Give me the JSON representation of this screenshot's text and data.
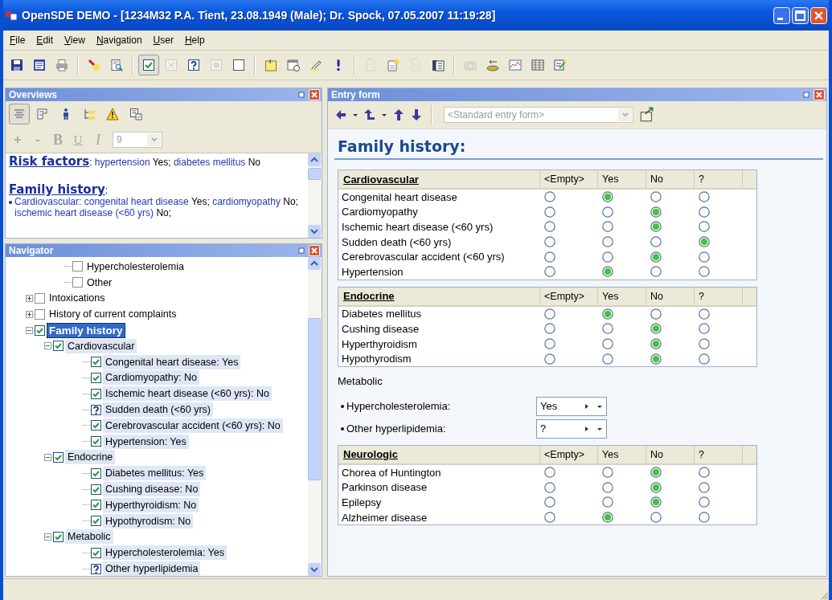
{
  "window": {
    "title": "OpenSDE DEMO - [1234M32 P.A. Tient, 23.08.1949 (Male); Dr. Spock, 07.05.2007 11:19:28]"
  },
  "menu": [
    "File",
    "Edit",
    "View",
    "Navigation",
    "User",
    "Help"
  ],
  "toolbar": [
    [
      {
        "pressed": false,
        "disabled": false
      },
      {
        "pressed": false,
        "disabled": false
      },
      {
        "pressed": false,
        "disabled": false
      }
    ],
    [
      {
        "pressed": false,
        "disabled": false
      },
      {
        "pressed": false,
        "disabled": false
      }
    ],
    [
      {
        "pressed": true,
        "disabled": false
      },
      {
        "pressed": false,
        "disabled": true
      },
      {
        "pressed": false,
        "disabled": false
      },
      {
        "pressed": false,
        "disabled": true
      },
      {
        "pressed": false,
        "disabled": false
      }
    ],
    [
      {
        "pressed": false,
        "disabled": false
      },
      {
        "pressed": false,
        "disabled": false
      },
      {
        "pressed": false,
        "disabled": false
      },
      {
        "pressed": false,
        "disabled": false
      }
    ],
    [
      {
        "pressed": false,
        "disabled": true
      },
      {
        "pressed": false,
        "disabled": false
      },
      {
        "pressed": false,
        "disabled": true
      },
      {
        "pressed": false,
        "disabled": false
      }
    ],
    [
      {
        "pressed": false,
        "disabled": true
      },
      {
        "pressed": false,
        "disabled": false
      },
      {
        "pressed": false,
        "disabled": false
      },
      {
        "pressed": false,
        "disabled": false
      },
      {
        "pressed": false,
        "disabled": false
      }
    ]
  ],
  "overviews": {
    "title": "Overviews",
    "tools": [
      {
        "pressed": true
      },
      {
        "pressed": false
      },
      {
        "pressed": false
      },
      {
        "pressed": false
      },
      {
        "pressed": false
      },
      {
        "pressed": false
      }
    ],
    "format_tools": [
      {
        "kind": "add",
        "label": "+",
        "disabled": true
      },
      {
        "kind": "remove",
        "label": "-",
        "disabled": true
      },
      {
        "kind": "bold",
        "label": "B",
        "disabled": true
      },
      {
        "kind": "underline",
        "label": "U",
        "disabled": true
      },
      {
        "kind": "italic",
        "label": "I",
        "disabled": true
      }
    ],
    "font_size": {
      "value": "9",
      "disabled": true
    },
    "sections": [
      {
        "kind": "inline",
        "heading": "Risk factors",
        "segments": [
          {
            "text": ": ",
            "term": false
          },
          {
            "text": "hypertension",
            "term": true
          },
          {
            "text": " Yes; ",
            "term": false
          },
          {
            "text": "diabetes mellitus",
            "term": true
          },
          {
            "text": " No",
            "term": false
          }
        ]
      },
      {
        "kind": "block",
        "heading": "Family history",
        "segments": [
          {
            "text": ":",
            "term": false
          }
        ],
        "bullets": [
          [
            {
              "text": "Cardiovascular: congenital heart disease",
              "term": true
            },
            {
              "text": " Yes; ",
              "term": false
            },
            {
              "text": "cardiomyopathy",
              "term": true
            },
            {
              "text": " No; ",
              "term": false
            },
            {
              "text": "ischemic heart disease (<60 yrs)",
              "term": true
            },
            {
              "text": " No;",
              "term": false
            }
          ]
        ]
      }
    ]
  },
  "navigator": {
    "title": "Navigator",
    "items": [
      {
        "children": [
          {
            "label": "Hypercholesterolemia",
            "checked": false,
            "unknown": false,
            "selected": false,
            "highlighted": false
          },
          {
            "label": "Other",
            "checked": false,
            "unknown": false,
            "selected": false,
            "highlighted": false
          }
        ]
      },
      {
        "label": "Intoxications",
        "checked": false,
        "unknown": false,
        "expanded": false,
        "selected": false,
        "highlighted": false
      },
      {
        "label": "History of current complaints",
        "checked": false,
        "unknown": false,
        "expanded": false,
        "selected": false,
        "highlighted": false
      },
      {
        "label": "Family history",
        "checked": true,
        "unknown": false,
        "expanded": true,
        "selected": true,
        "highlighted": false,
        "children": [
          {
            "label": "Cardiovascular",
            "checked": true,
            "unknown": false,
            "expanded": true,
            "selected": false,
            "highlighted": true,
            "children": [
              {
                "label": "Congenital heart disease: Yes",
                "checked": true,
                "unknown": false,
                "selected": false,
                "highlighted": true
              },
              {
                "label": "Cardiomyopathy: No",
                "checked": true,
                "unknown": false,
                "selected": false,
                "highlighted": true
              },
              {
                "label": "Ischemic heart disease (<60 yrs): No",
                "checked": true,
                "unknown": false,
                "selected": false,
                "highlighted": true
              },
              {
                "label": "Sudden death (<60 yrs)",
                "checked": false,
                "unknown": true,
                "selected": false,
                "highlighted": true
              },
              {
                "label": "Cerebrovascular accident (<60 yrs): No",
                "checked": true,
                "unknown": false,
                "selected": false,
                "highlighted": true
              },
              {
                "label": "Hypertension: Yes",
                "checked": true,
                "unknown": false,
                "selected": false,
                "highlighted": true
              }
            ]
          },
          {
            "label": "Endocrine",
            "checked": true,
            "unknown": false,
            "expanded": true,
            "selected": false,
            "highlighted": true,
            "children": [
              {
                "label": "Diabetes mellitus: Yes",
                "checked": true,
                "unknown": false,
                "selected": false,
                "highlighted": true
              },
              {
                "label": "Cushing disease: No",
                "checked": true,
                "unknown": false,
                "selected": false,
                "highlighted": true
              },
              {
                "label": "Hyperthyroidism: No",
                "checked": true,
                "unknown": false,
                "selected": false,
                "highlighted": true
              },
              {
                "label": "Hypothyrodism: No",
                "checked": true,
                "unknown": false,
                "selected": false,
                "highlighted": true
              }
            ]
          },
          {
            "label": "Metabolic",
            "checked": true,
            "unknown": false,
            "expanded": true,
            "selected": false,
            "highlighted": true,
            "children": [
              {
                "label": "Hypercholesterolemia: Yes",
                "checked": true,
                "unknown": false,
                "selected": false,
                "highlighted": true
              },
              {
                "label": "Other hyperlipidemia",
                "checked": false,
                "unknown": true,
                "selected": false,
                "highlighted": true
              }
            ]
          }
        ]
      }
    ]
  },
  "entry_form": {
    "title": "Entry form",
    "template": {
      "value": "<Standard entry form>",
      "disabled": true
    },
    "heading": "Family history:",
    "sections": [
      {
        "kind": "grid",
        "title": "Cardiovascular",
        "columns": [
          "<Empty>",
          "Yes",
          "No",
          "?"
        ],
        "rows": [
          {
            "label": "Congenital heart disease",
            "options": [
              {
                "selected": false
              },
              {
                "selected": true
              },
              {
                "selected": false
              },
              {
                "selected": false
              }
            ]
          },
          {
            "label": "Cardiomyopathy",
            "options": [
              {
                "selected": false
              },
              {
                "selected": false
              },
              {
                "selected": true
              },
              {
                "selected": false
              }
            ]
          },
          {
            "label": "Ischemic heart disease (<60 yrs)",
            "options": [
              {
                "selected": false
              },
              {
                "selected": false
              },
              {
                "selected": true
              },
              {
                "selected": false
              }
            ]
          },
          {
            "label": "Sudden death (<60 yrs)",
            "options": [
              {
                "selected": false
              },
              {
                "selected": false
              },
              {
                "selected": false
              },
              {
                "selected": true
              }
            ]
          },
          {
            "label": "Cerebrovascular accident (<60 yrs)",
            "options": [
              {
                "selected": false
              },
              {
                "selected": false
              },
              {
                "selected": true
              },
              {
                "selected": false
              }
            ]
          },
          {
            "label": "Hypertension",
            "options": [
              {
                "selected": false
              },
              {
                "selected": true
              },
              {
                "selected": false
              },
              {
                "selected": false
              }
            ]
          }
        ]
      },
      {
        "kind": "grid",
        "title": "Endocrine",
        "columns": [
          "<Empty>",
          "Yes",
          "No",
          "?"
        ],
        "rows": [
          {
            "label": "Diabetes mellitus",
            "options": [
              {
                "selected": false
              },
              {
                "selected": true
              },
              {
                "selected": false
              },
              {
                "selected": false
              }
            ]
          },
          {
            "label": "Cushing disease",
            "options": [
              {
                "selected": false
              },
              {
                "selected": false
              },
              {
                "selected": true
              },
              {
                "selected": false
              }
            ]
          },
          {
            "label": "Hyperthyroidism",
            "options": [
              {
                "selected": false
              },
              {
                "selected": false
              },
              {
                "selected": true
              },
              {
                "selected": false
              }
            ]
          },
          {
            "label": "Hypothyrodism",
            "options": [
              {
                "selected": false
              },
              {
                "selected": false
              },
              {
                "selected": true
              },
              {
                "selected": false
              }
            ]
          }
        ]
      },
      {
        "kind": "fields",
        "title": "Metabolic",
        "fields": [
          {
            "label": "Hypercholesterolemia:",
            "value": "Yes"
          },
          {
            "label": "Other hyperlipidemia:",
            "value": "?"
          }
        ]
      },
      {
        "kind": "grid",
        "title": "Neurologic",
        "columns": [
          "<Empty>",
          "Yes",
          "No",
          "?"
        ],
        "rows": [
          {
            "label": "Chorea of Huntington",
            "options": [
              {
                "selected": false
              },
              {
                "selected": false
              },
              {
                "selected": true
              },
              {
                "selected": false
              }
            ]
          },
          {
            "label": "Parkinson disease",
            "options": [
              {
                "selected": false
              },
              {
                "selected": false
              },
              {
                "selected": true
              },
              {
                "selected": false
              }
            ]
          },
          {
            "label": "Epilepsy",
            "options": [
              {
                "selected": false
              },
              {
                "selected": false
              },
              {
                "selected": true
              },
              {
                "selected": false
              }
            ]
          },
          {
            "label": "Alzheimer disease",
            "options": [
              {
                "selected": false
              },
              {
                "selected": true
              },
              {
                "selected": false
              },
              {
                "selected": false
              }
            ]
          }
        ]
      }
    ]
  }
}
